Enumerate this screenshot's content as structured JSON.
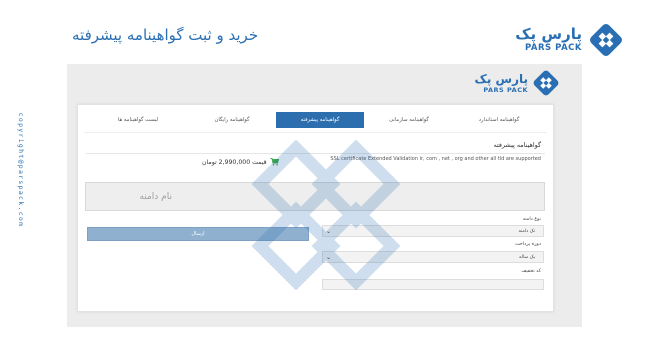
{
  "header": {
    "title": "خرید و ثبت گواهینامه پیشرفته",
    "brand_fa": "پارس پک",
    "brand_en": "PARS PACK"
  },
  "side_copyright": "copyright@parspack.com",
  "colors": {
    "brand_blue": "#2a6fb3",
    "tab_active": "#2d6fae",
    "submit_button": "#8fb0cf",
    "cart_green": "#3aa84c"
  },
  "card": {
    "tabs": [
      {
        "label": "گواهینامه استاندارد",
        "active": false
      },
      {
        "label": "گواهینامه سازمانی",
        "active": false
      },
      {
        "label": "گواهینامه پیشرفته",
        "active": true
      },
      {
        "label": "گواهینامه رایگان",
        "active": false
      },
      {
        "label": "لیست گواهینامه ها",
        "active": false
      }
    ],
    "section_title": "گواهینامه پیشرفته",
    "product_description": "SSL certificate Extended Validation ir, com , net , org and other all tld are supported",
    "price_text": "قیمت 2,990,000 تومان",
    "domain_placeholder": "نام دامنه",
    "form": {
      "domain_type_label": "نوع دامنه",
      "domain_type_value": "تک دامنه",
      "period_label": "دوره پرداخت",
      "period_value": "یک ساله",
      "discount_label": "کد تخفیف",
      "submit_label": "ارسال"
    }
  },
  "icons": {
    "brand_logo": "diamond-grid-logo-icon",
    "cart": "shopping-cart-icon",
    "dropdown": "chevron-down-icon",
    "watermark": "diamond-grid-watermark-icon"
  }
}
